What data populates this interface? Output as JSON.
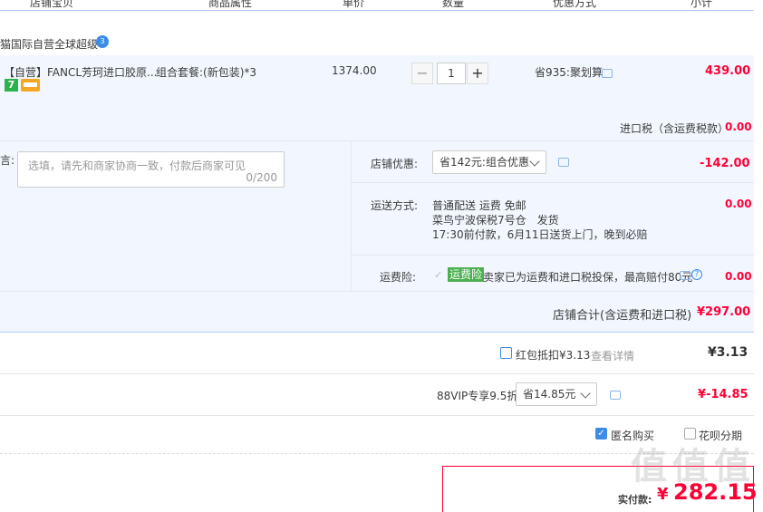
{
  "columns": [
    "店铺宝贝",
    "商品属性",
    "单价",
    "数量",
    "优惠方式",
    "小计"
  ],
  "shop": {
    "name": "猫国际自营全球超级",
    "badge": "3"
  },
  "item": {
    "title": "【自营】FANCL芳珂进口胶原...",
    "attrs": "组合套餐:(新包装)*3",
    "price": "1374.00",
    "qty_minus": "−",
    "qty": "1",
    "qty_plus": "+",
    "discount": "省935:聚划算",
    "subtotal": "439.00",
    "badge_seven": "7"
  },
  "tax": {
    "label": "进口税（含运费税款）",
    "value": "0.00"
  },
  "message": {
    "label": "言:",
    "placeholder": "选填，请先和商家协商一致，付款后商家可见",
    "counter": "0/200"
  },
  "shop_discount": {
    "label": "店铺优惠:",
    "selected": "省142元:组合优惠",
    "value": "-142.00"
  },
  "shipping": {
    "label": "运送方式:",
    "line1": "普通配送 运费 免邮",
    "line2": "菜鸟宁波保税7号仓　发货",
    "line3": "17:30前付款，6月11日送货上门，晚到必赔",
    "value": "0.00"
  },
  "insurance": {
    "label": "运费险:",
    "tag": "运费险",
    "desc": "卖家已为运费和进口税投保，最高赔付80元",
    "help": "?",
    "value": "0.00"
  },
  "shop_total": {
    "label": "店铺合计(含运费和进口税)",
    "value": "¥297.00"
  },
  "redpacket": {
    "label": "红包抵扣¥3.13",
    "link": "查看详情",
    "value": "¥3.13"
  },
  "vip": {
    "label": "88VIP专享9.5折",
    "selected": "省14.85元",
    "value": "¥-14.85"
  },
  "options": {
    "anonymous": "匿名购买",
    "installment": "花呗分期"
  },
  "pay": {
    "label": "实付款:",
    "currency": "¥",
    "amount": "282.15"
  },
  "watermark": "值 值 值"
}
